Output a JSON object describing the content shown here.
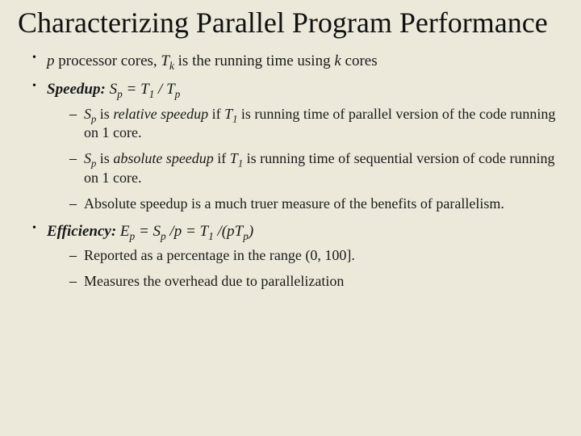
{
  "title": "Characterizing Parallel Program Performance",
  "bullets": {
    "b1": {
      "var_p": "p",
      "t1": " processor cores, ",
      "var_Tk": "T",
      "sub_k": "k",
      "t2": " is the running time using ",
      "var_k": "k",
      "t3": " cores"
    },
    "b2": {
      "label": "Speedup:",
      "sp": "   ",
      "var_Sp": "S",
      "sub_p1": "p",
      "eq1": " = ",
      "var_T1": "T",
      "sub_1": "1",
      "div": " / ",
      "var_Tp": "T",
      "sub_p2": "p",
      "s1": {
        "var_Sp": "S",
        "sub_p": "p",
        "t1": " is  ",
        "em": "relative speedup",
        "t2": " if ",
        "var_T1": "T",
        "sub_1": "1",
        "t3": " is running time of parallel version of the code running on 1 core."
      },
      "s2": {
        "var_Sp": "S",
        "sub_p": "p",
        "t1": " is ",
        "em": "absolute speedup",
        "t2": " if ",
        "var_T1": "T",
        "sub_1": "1",
        "t3": " is running time of sequential version of code running on 1 core."
      },
      "s3": "Absolute speedup is a much truer measure of the benefits of parallelism."
    },
    "b3": {
      "label": "Efficiency:",
      "sp": "  ",
      "var_Ep": "E",
      "sub_p1": "p",
      "eq1": " = ",
      "var_Sp": "S",
      "sub_p2": "p",
      "t_div_p": " /p = ",
      "var_T1": "T",
      "sub_1": "1",
      "t_div2": " /(p",
      "var_Tp": "T",
      "sub_p3": "p",
      "close": ")",
      "s1": "Reported as a percentage in the range (0, 100].",
      "s2": "Measures the overhead due to parallelization"
    }
  }
}
